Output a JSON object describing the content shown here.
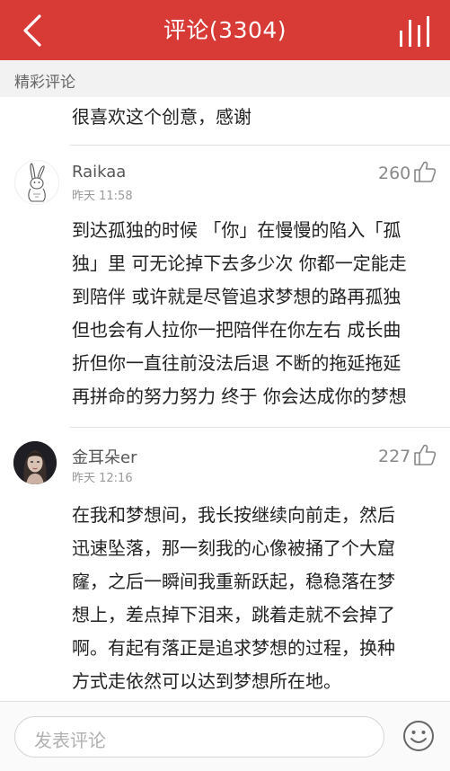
{
  "header": {
    "title": "评论(3304)"
  },
  "section": {
    "label": "精彩评论"
  },
  "comments": [
    {
      "body_lines": [
        "很喜欢这个创意，感谢"
      ]
    },
    {
      "username": "Raikaa",
      "time": "昨天 11:58",
      "likes": "260",
      "body_lines": [
        "到达孤独的时候 「你」在慢慢的陷入「孤",
        "独」里 可无论掉下去多少次 你都一定能走",
        "到陪伴 或许就是尽管追求梦想的路再孤独",
        "但也会有人拉你一把陪伴在你左右 成长曲",
        "折但你一直往前没法后退 不断的拖延拖延",
        "再拼命的努力努力 终于 你会达成你的梦想"
      ]
    },
    {
      "username": "金耳朵er",
      "time": "昨天 12:16",
      "likes": "227",
      "body_lines": [
        "在我和梦想间，我长按继续向前走，然后",
        "迅速坠落，那一刻我的心像被捅了个大窟",
        "窿，之后一瞬间我重新跃起，稳稳落在梦",
        "想上，差点掉下泪来，跳着走就不会掉了",
        "啊。有起有落正是追求梦想的过程，换种",
        "方式走依然可以达到梦想所在地。"
      ]
    }
  ],
  "footer": {
    "input_placeholder": "发表评论",
    "emoji_icon": "smiley-icon"
  },
  "colors": {
    "header_bg": "#d83a36",
    "section_bg": "#f2f2f2"
  }
}
